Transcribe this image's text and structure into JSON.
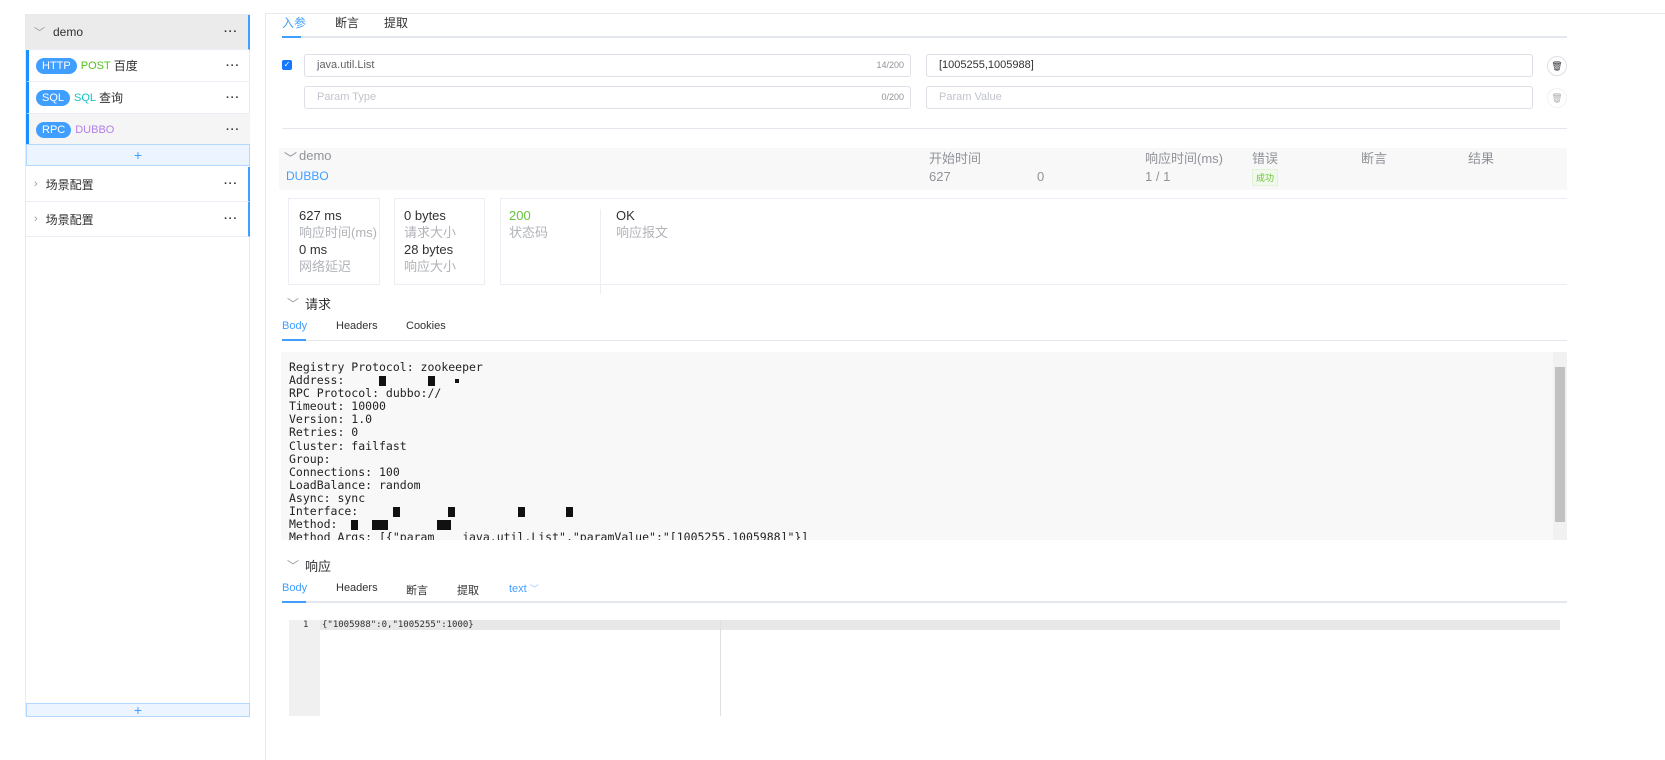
{
  "sidebar": {
    "group": {
      "name": "demo",
      "more": "···"
    },
    "items": [
      {
        "badge": "HTTP",
        "method": "POST",
        "name": "百度",
        "method_color": "#52c41a"
      },
      {
        "badge": "SQL",
        "method": "SQL",
        "name": "查询",
        "method_color": "#13c2c2"
      },
      {
        "badge": "RPC",
        "method": "DUBBO",
        "name": "",
        "method_color": "#b37feb"
      }
    ],
    "add": "+",
    "scenarios": [
      {
        "name": "场景配置"
      },
      {
        "name": "场景配置"
      }
    ]
  },
  "tabs": [
    "入参",
    "断言",
    "提取"
  ],
  "params": [
    {
      "checked": true,
      "type": "java.util.List",
      "type_count": "14/200",
      "value": "[1005255,1005988]"
    },
    {
      "checked": false,
      "type": "",
      "type_placeholder": "Param Type",
      "type_count": "0/200",
      "value": "",
      "value_placeholder": "Param Value"
    }
  ],
  "summary": {
    "name": "demo",
    "protocol": "DUBBO",
    "headers": [
      "开始时间",
      "响应时间(ms)",
      "错误",
      "断言",
      "结果"
    ],
    "start": "627",
    "col2": "0",
    "ratio": "1 / 1",
    "result": "成功"
  },
  "metrics": {
    "resp_time": "627 ms",
    "resp_time_label": "响应时间(ms)",
    "latency": "0 ms",
    "latency_label": "网络延迟",
    "req_size": "0 bytes",
    "req_size_label": "请求大小",
    "resp_size": "28 bytes",
    "resp_size_label": "响应大小",
    "status": "200",
    "status_label": "状态码",
    "status_color": "#67c23a",
    "message": "OK",
    "message_label": "响应报文"
  },
  "request": {
    "title": "请求",
    "tabs": [
      "Body",
      "Headers",
      "Cookies"
    ],
    "lines": [
      "Registry Protocol: zookeeper",
      "Address: ",
      "RPC Protocol: dubbo://",
      "Timeout: 10000",
      "Version: 1.0",
      "Retries: 0",
      "Cluster: failfast",
      "Group:",
      "Connections: 100",
      "LoadBalance: random",
      "Async: sync",
      "Interface:",
      "Method:",
      "Method Args: [{\"param    java.util.List\",\"paramValue\":\"[1005255,1005988]\"}]"
    ]
  },
  "response": {
    "title": "响应",
    "tabs": [
      "Body",
      "Headers",
      "断言",
      "提取"
    ],
    "format": "text",
    "line_no": "1",
    "body": "{\"1005988\":0,\"1005255\":1000}"
  }
}
